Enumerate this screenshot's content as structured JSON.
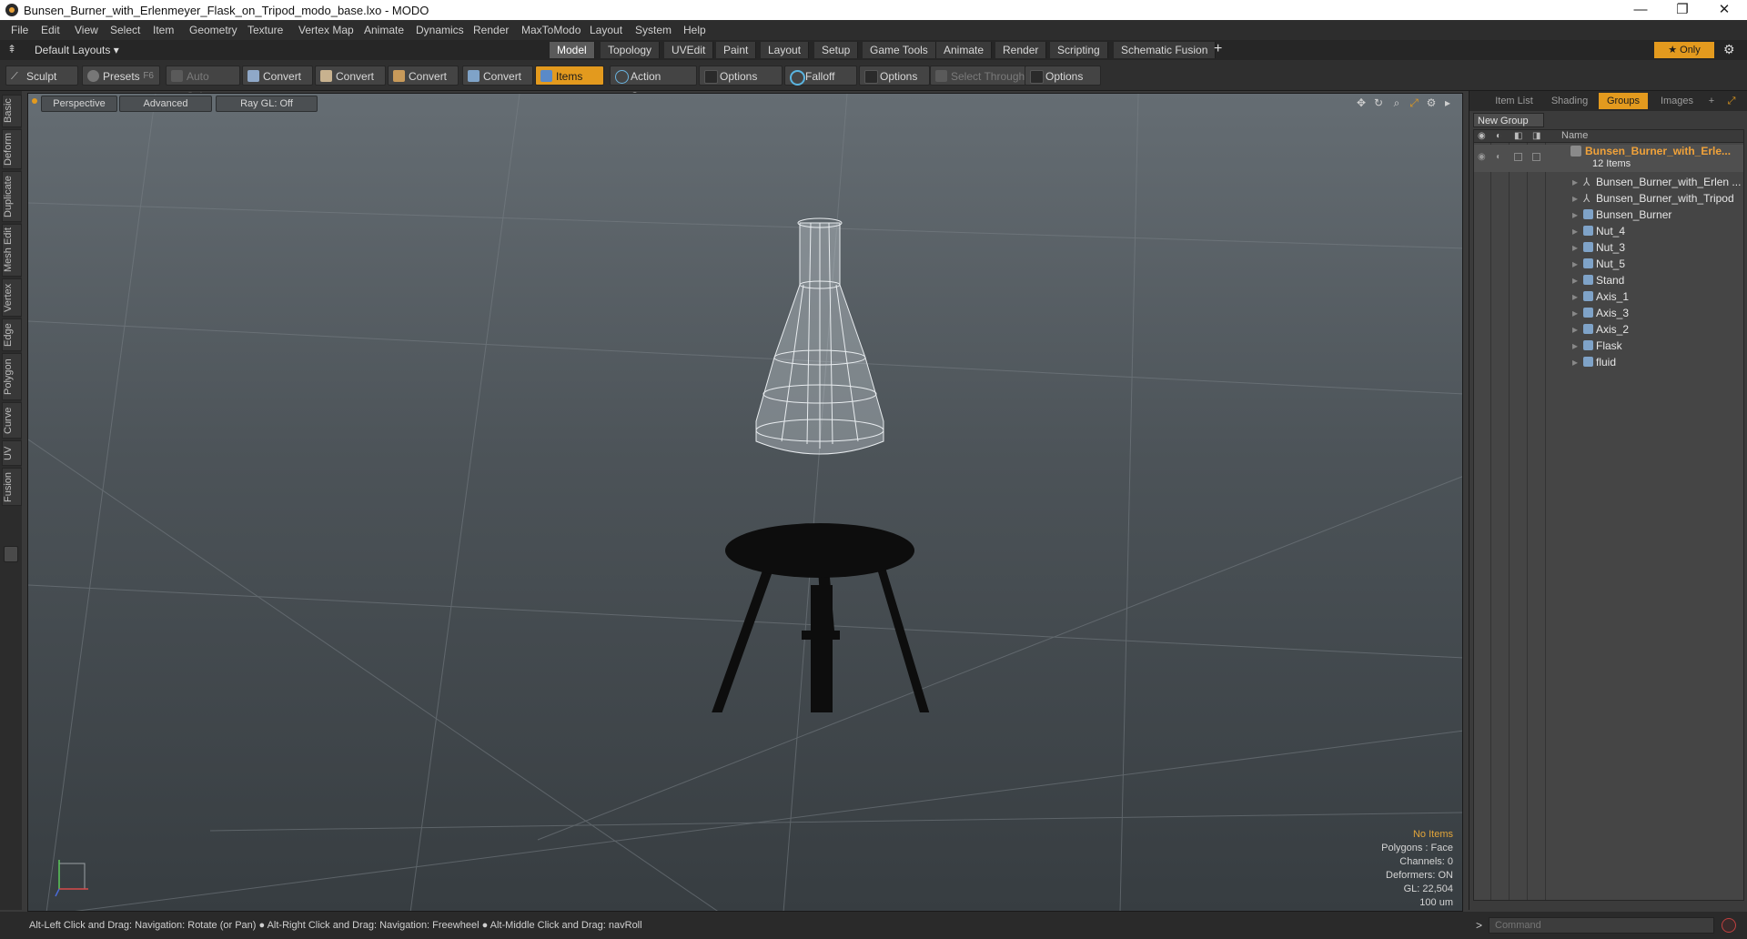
{
  "window": {
    "title": "Bunsen_Burner_with_Erlenmeyer_Flask_on_Tripod_modo_base.lxo - MODO",
    "minimize": "—",
    "maximize": "❐",
    "close": "✕"
  },
  "menu": [
    "File",
    "Edit",
    "View",
    "Select",
    "Item",
    "Geometry",
    "Texture",
    "Vertex Map",
    "Animate",
    "Dynamics",
    "Render",
    "MaxToModo",
    "Layout",
    "System",
    "Help"
  ],
  "layout_bar": {
    "layouts_label": "Default Layouts",
    "tabs": [
      "Model",
      "Topology",
      "UVEdit",
      "Paint",
      "Layout",
      "Setup",
      "Game Tools",
      "Animate",
      "Render",
      "Scripting",
      "Schematic Fusion"
    ],
    "active_tab": "Model",
    "add_label": "+",
    "only_label": "★  Only"
  },
  "toolbar": {
    "sculpt": "Sculpt",
    "presets": "Presets",
    "presets_key": "F6",
    "auto_select": "Auto Select",
    "convert_1": "Convert",
    "convert_2": "Convert",
    "convert_3": "Convert",
    "convert_4": "Convert",
    "items": "Items",
    "action_center": "Action Center",
    "options_1": "Options",
    "falloff": "Falloff",
    "options_2": "Options",
    "select_through": "Select Through",
    "options_3": "Options"
  },
  "left_tabs": [
    "Basic",
    "Deform",
    "Duplicate",
    "Mesh Edit",
    "Vertex",
    "Edge",
    "Polygon",
    "Curve",
    "UV",
    "Fusion"
  ],
  "viewport": {
    "perspective": "Perspective",
    "advanced": "Advanced",
    "raygl": "Ray GL: Off",
    "stats": {
      "no_items": "No Items",
      "polygons": "Polygons : Face",
      "channels": "Channels: 0",
      "deformers": "Deformers: ON",
      "gl": "GL: 22,504",
      "unit": "100 um"
    },
    "axis_y": "Y",
    "axis_x": "X",
    "axis_z": "Z"
  },
  "right_panel": {
    "tabs": [
      "Item List",
      "Shading",
      "Groups",
      "Images"
    ],
    "active_tab": "Groups",
    "add_tab": "+",
    "new_group": "New Group",
    "name_header": "Name",
    "group_name": "Bunsen_Burner_with_Erle...",
    "group_count": "12 Items",
    "items": [
      "Bunsen_Burner_with_Erlen ...",
      "Bunsen_Burner_with_Tripod",
      "Bunsen_Burner",
      "Nut_4",
      "Nut_3",
      "Nut_5",
      "Stand",
      "Axis_1",
      "Axis_3",
      "Axis_2",
      "Flask",
      "fluid"
    ]
  },
  "status": {
    "hint": "Alt-Left Click and Drag: Navigation: Rotate (or Pan) ● Alt-Right Click and Drag: Navigation: Freewheel ● Alt-Middle Click and Drag: navRoll",
    "command_prompt": ">",
    "command_placeholder": "Command"
  },
  "colors": {
    "accent": "#e39a1e",
    "viewport_top": "#656d73",
    "viewport_bottom": "#373d41",
    "panel_bg": "#3b3b3b"
  }
}
